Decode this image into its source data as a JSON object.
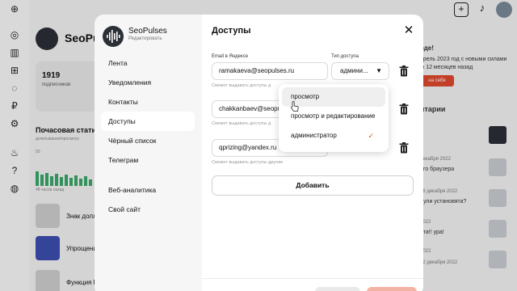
{
  "background": {
    "channel_name": "SeoPuls",
    "subscribers_count": "1919",
    "subscribers_label": "подписчиков",
    "hourly_title": "Почасовая стати",
    "hourly_sub": "дочитывания/просмотр",
    "chart_top_value": "50",
    "chart_bottom_label": "48 часов назад",
    "list_items": [
      "Знак долл",
      "Упрощени",
      "Функция В"
    ],
    "right_texts": [
      "рде!",
      "прель 2023 год с новыми силами",
      "ю 12 месяцев назад",
      "нтарии",
      "декабря 2022",
      "ого браузера",
      "16 декабря 2022",
      "дули установята?",
      "2022",
      "ата!! ура!",
      "2022",
      "12 декабря 2022"
    ],
    "right_button": "на себя"
  },
  "modal": {
    "channel_name": "SeoPulses",
    "channel_action": "Редактировать",
    "nav": [
      {
        "label": "Лента"
      },
      {
        "label": "Уведомления"
      },
      {
        "label": "Контакты"
      },
      {
        "label": "Доступы"
      },
      {
        "label": "Чёрный список"
      },
      {
        "label": "Телеграм"
      },
      {
        "label": "Веб-аналитика"
      },
      {
        "label": "Свой сайт"
      }
    ],
    "active_nav": "Доступы",
    "title": "Доступы",
    "col_email_header": "Email в Яндексе",
    "col_access_header": "Тип доступа",
    "rows": [
      {
        "email": "ramakaeva@seopulses.ru",
        "access": "админи...",
        "hint": "Сможет выдавать доступы д"
      },
      {
        "email": "chakkanbaev@seopulses.ru",
        "access": "",
        "hint": "Сможет выдавать доступы д"
      },
      {
        "email": "qprizing@yandex.ru",
        "access": "",
        "hint": "Сможет выдавать доступы другим"
      }
    ],
    "add_button": "Добавить"
  },
  "dropdown": {
    "options": [
      "просмотр",
      "просмотр и редактирование",
      "администратор"
    ],
    "selected": "администратор",
    "hovered": "просмотр"
  },
  "colors": {
    "accent": "#e14a2f",
    "chart_bar": "#3aa86a"
  }
}
